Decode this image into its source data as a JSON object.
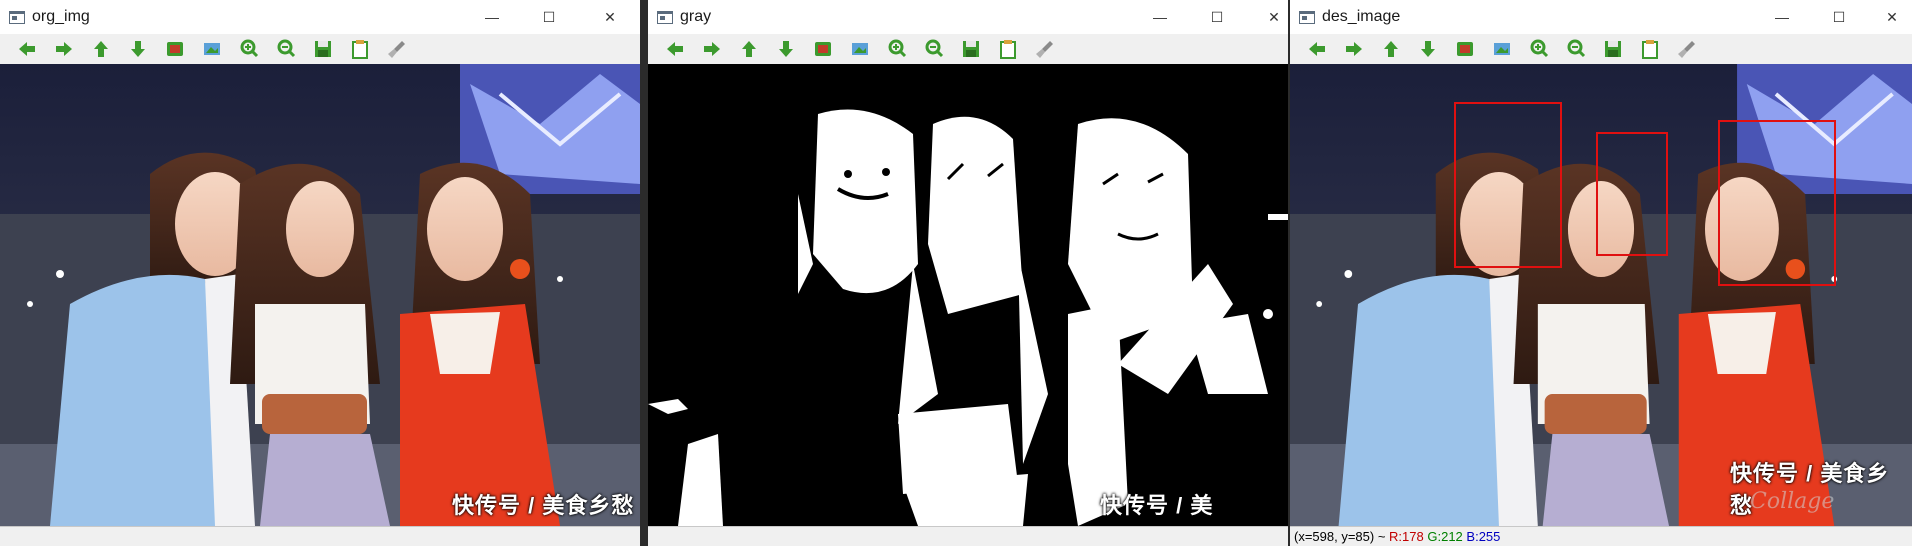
{
  "windows": [
    {
      "title": "org_img",
      "mode": "color",
      "caption": "快传号 / 美食乡愁",
      "status": ""
    },
    {
      "title": "gray",
      "mode": "binary",
      "caption": "快传号 / 美",
      "status": ""
    },
    {
      "title": "des_image",
      "mode": "color",
      "caption": "快传号 / 美食乡愁",
      "status_prefix": "(x=598, y=85) ~ ",
      "r_label": "R:178",
      "g_label": "G:212",
      "b_label": "B:255",
      "watermark": "Collage"
    }
  ],
  "window_controls": {
    "minimize": "—",
    "maximize": "☐",
    "close": "✕"
  },
  "toolbar_icons": [
    "arrow-left-icon",
    "arrow-right-icon",
    "arrow-up-icon",
    "arrow-down-icon",
    "image-icon",
    "zoom-fit-icon",
    "zoom-in-icon",
    "zoom-out-icon",
    "save-icon",
    "properties-icon",
    "clear-icon"
  ],
  "colors": {
    "box": "#e01010",
    "icon_green": "#3c9a2e"
  }
}
